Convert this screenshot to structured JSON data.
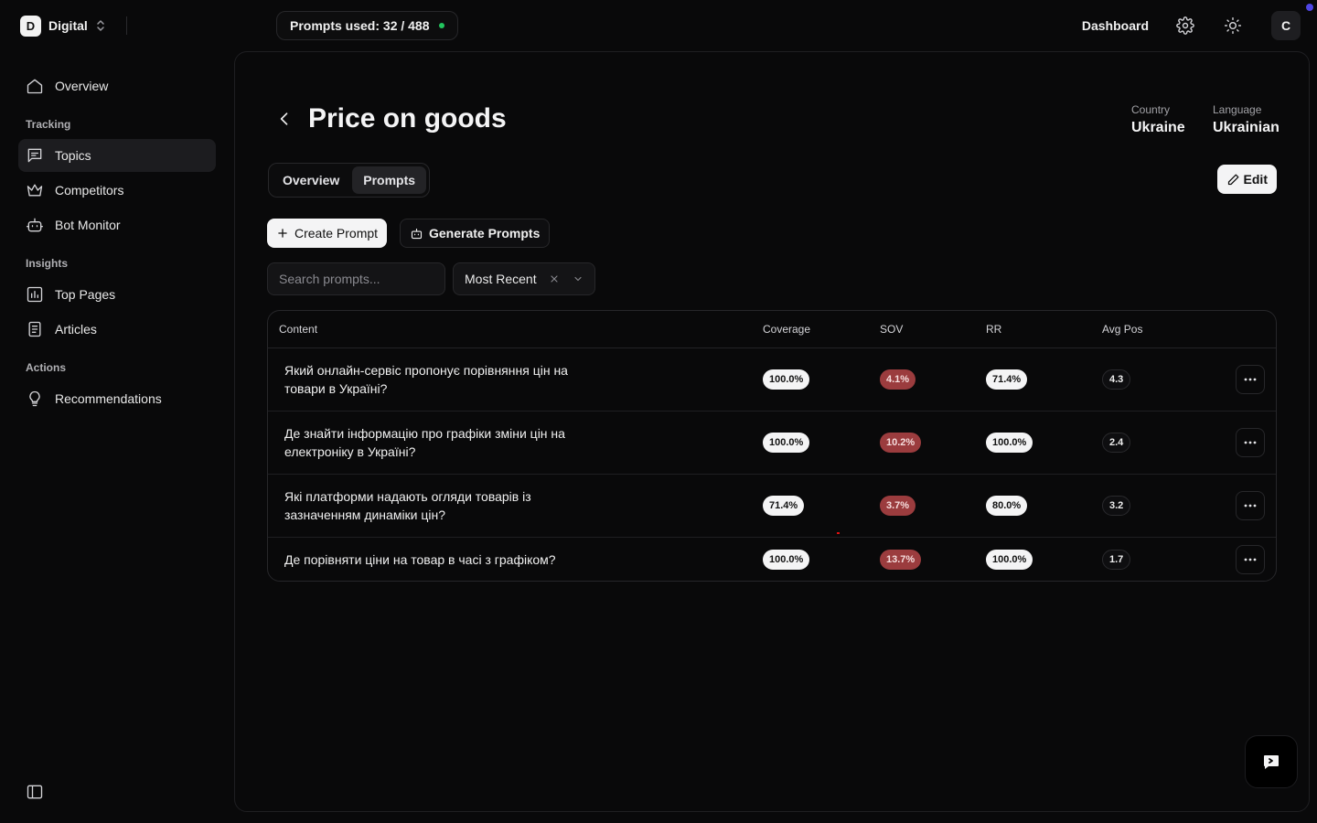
{
  "workspace": {
    "initial": "D",
    "name": "Digital"
  },
  "usage": {
    "text": "Prompts used: 32 / 488",
    "dot_color": "#22c55e"
  },
  "topbar": {
    "dashboard": "Dashboard",
    "avatar_initial": "C"
  },
  "sidebar": {
    "overview": "Overview",
    "sections": {
      "tracking": "Tracking",
      "insights": "Insights",
      "actions": "Actions"
    },
    "items": {
      "topics": "Topics",
      "competitors": "Competitors",
      "bot_monitor": "Bot Monitor",
      "top_pages": "Top Pages",
      "articles": "Articles",
      "recommendations": "Recommendations"
    },
    "active_item": "Topics"
  },
  "page": {
    "title": "Price on goods",
    "country_label": "Country",
    "country_value": "Ukraine",
    "language_label": "Language",
    "language_value": "Ukrainian",
    "tabs": [
      "Overview",
      "Prompts"
    ],
    "active_tab": "Prompts",
    "edit_label": "Edit",
    "create_label": "Create Prompt",
    "generate_label": "Generate Prompts",
    "search_placeholder": "Search prompts...",
    "sort_value": "Most Recent"
  },
  "table": {
    "columns": [
      "Content",
      "Coverage",
      "SOV",
      "RR",
      "Avg Pos"
    ],
    "rows": [
      {
        "content": "Який онлайн-сервіс пропонує порівняння цін на товари в Україні?",
        "coverage": "100.0%",
        "sov": "4.1%",
        "rr": "71.4%",
        "avg_pos": "4.3"
      },
      {
        "content": "Де знайти інформацію про графіки зміни цін на електроніку в Україні?",
        "coverage": "100.0%",
        "sov": "10.2%",
        "rr": "100.0%",
        "avg_pos": "2.4"
      },
      {
        "content": "Які платформи надають огляди товарів із зазначенням динаміки цін?",
        "coverage": "71.4%",
        "sov": "3.7%",
        "rr": "80.0%",
        "avg_pos": "3.2"
      },
      {
        "content": "Де порівняти ціни на товар в часі з графіком?",
        "coverage": "100.0%",
        "sov": "13.7%",
        "rr": "100.0%",
        "avg_pos": "1.7"
      }
    ]
  },
  "colors": {
    "sov_pill": "#9b3c3e",
    "accent_dot": "#4f46e5"
  }
}
